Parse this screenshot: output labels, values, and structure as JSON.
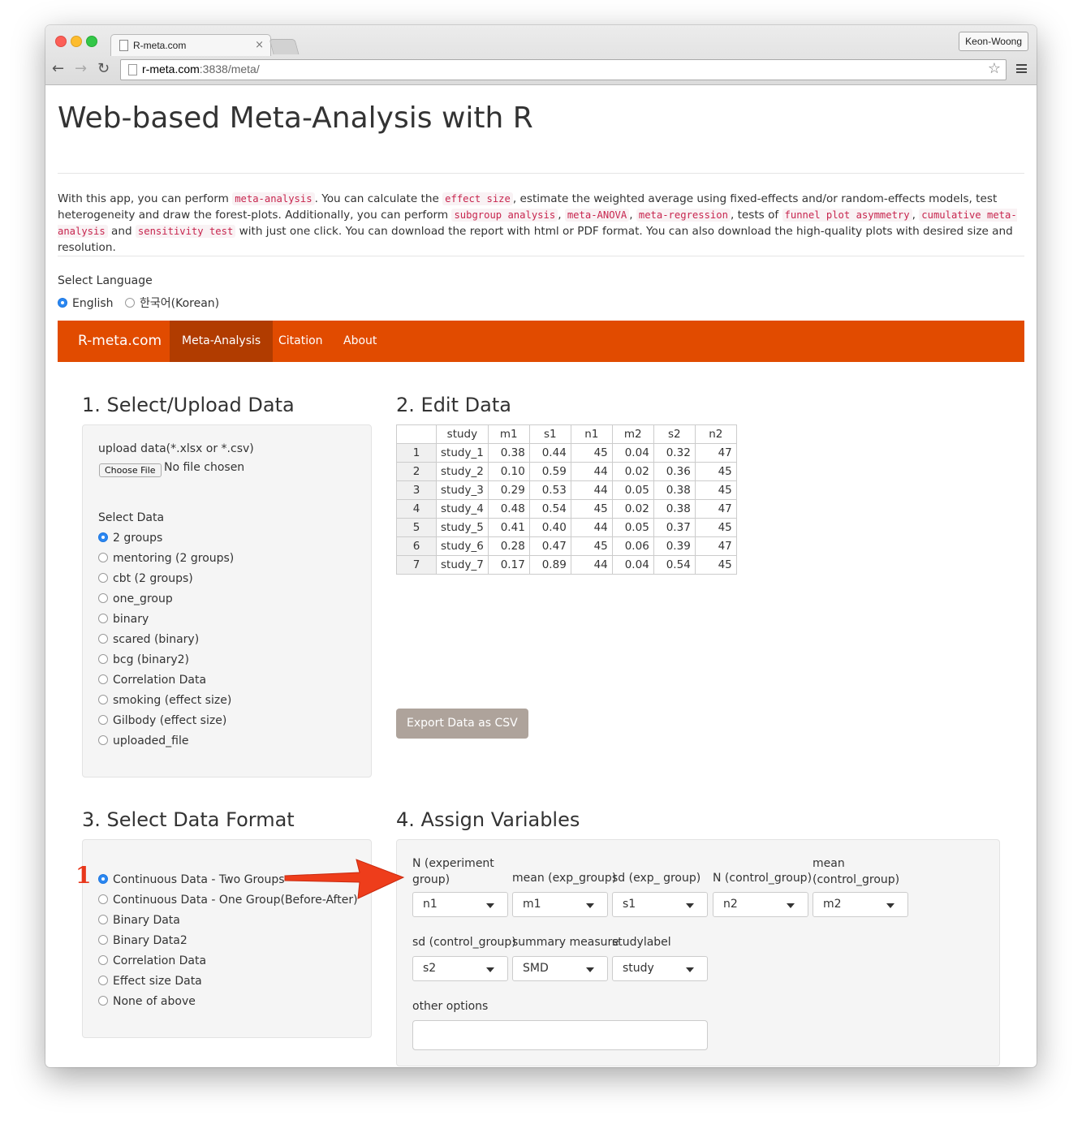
{
  "browser": {
    "tab_title": "R-meta.com",
    "tab_close": "×",
    "profile": "Keon-Woong",
    "url_host": "r-meta.com",
    "url_rest": ":3838/meta/",
    "back": "←",
    "forward": "→",
    "reload": "↻",
    "star": "☆"
  },
  "page": {
    "title": "Web-based Meta-Analysis with R",
    "intro": {
      "t1": "With this app, you can perform ",
      "c1": "meta-analysis",
      "t2": ". You can calculate the ",
      "c2": "effect size",
      "t3": ", estimate the weighted average using fixed-effects and/or random-effects models, test heterogeneity and draw the forest-plots. Additionally, you can perform ",
      "c3": "subgroup analysis",
      "t4": ", ",
      "c4": "meta-ANOVA",
      "t5": ", ",
      "c5": "meta-regression",
      "t6": ", tests of ",
      "c6": "funnel plot asymmetry",
      "t7": ", ",
      "c7": "cumulative meta-analysis",
      "t8": " and ",
      "c8": "sensitivity test",
      "t9": " with just one click. You can download the report with html or PDF format. You can also download the high-quality plots with desired size and resolution."
    },
    "language": {
      "label": "Select Language",
      "options": [
        "English",
        "한국어(Korean)"
      ],
      "selected": "English"
    }
  },
  "navbar": {
    "brand": "R-meta.com",
    "items": [
      "Meta-Analysis",
      "Citation",
      "About"
    ],
    "active": "Meta-Analysis",
    "color": "#e14b00"
  },
  "section1": {
    "title": "1. Select/Upload Data",
    "upload_label": "upload data(*.xlsx or *.csv)",
    "choose_file": "Choose File",
    "no_file": "No file chosen",
    "select_label": "Select Data",
    "options": [
      "2 groups",
      "mentoring (2 groups)",
      "cbt (2 groups)",
      "one_group",
      "binary",
      "scared (binary)",
      "bcg (binary2)",
      "Correlation Data",
      "smoking (effect size)",
      "Gilbody (effect size)",
      "uploaded_file"
    ],
    "selected": "2 groups"
  },
  "section2": {
    "title": "2. Edit Data",
    "columns": [
      "",
      "study",
      "m1",
      "s1",
      "n1",
      "m2",
      "s2",
      "n2"
    ],
    "rows": [
      [
        "1",
        "study_1",
        "0.38",
        "0.44",
        "45",
        "0.04",
        "0.32",
        "47"
      ],
      [
        "2",
        "study_2",
        "0.10",
        "0.59",
        "44",
        "0.02",
        "0.36",
        "45"
      ],
      [
        "3",
        "study_3",
        "0.29",
        "0.53",
        "44",
        "0.05",
        "0.38",
        "45"
      ],
      [
        "4",
        "study_4",
        "0.48",
        "0.54",
        "45",
        "0.02",
        "0.38",
        "47"
      ],
      [
        "5",
        "study_5",
        "0.41",
        "0.40",
        "44",
        "0.05",
        "0.37",
        "45"
      ],
      [
        "6",
        "study_6",
        "0.28",
        "0.47",
        "45",
        "0.06",
        "0.39",
        "47"
      ],
      [
        "7",
        "study_7",
        "0.17",
        "0.89",
        "44",
        "0.04",
        "0.54",
        "45"
      ]
    ],
    "export_button": "Export Data as CSV"
  },
  "section3": {
    "title": "3. Select Data Format",
    "options": [
      "Continuous Data - Two Groups",
      "Continuous Data - One Group(Before-After)",
      "Binary Data",
      "Binary Data2",
      "Correlation Data",
      "Effect size Data",
      "None of above"
    ],
    "selected": "Continuous Data - Two Groups",
    "annotation_number": "1"
  },
  "section4": {
    "title": "4. Assign Variables",
    "fields": [
      {
        "label_l1": "N (experiment",
        "label_l2": "group)",
        "value": "n1"
      },
      {
        "label_l1": "",
        "label_l2": "mean (exp_group)",
        "value": "m1"
      },
      {
        "label_l1": "",
        "label_l2": "sd (exp_ group)",
        "value": "s1"
      },
      {
        "label_l1": "",
        "label_l2": "N (control_group)",
        "value": "n2"
      },
      {
        "label_l1": "mean",
        "label_l2": "(control_group)",
        "value": "m2"
      },
      {
        "label_l1": "",
        "label_l2": "sd (control_group)",
        "value": "s2"
      },
      {
        "label_l1": "",
        "label_l2": "summary measure",
        "value": "SMD"
      },
      {
        "label_l1": "",
        "label_l2": "studylabel",
        "value": "study"
      }
    ],
    "other_options_label": "other options",
    "other_options_value": ""
  }
}
